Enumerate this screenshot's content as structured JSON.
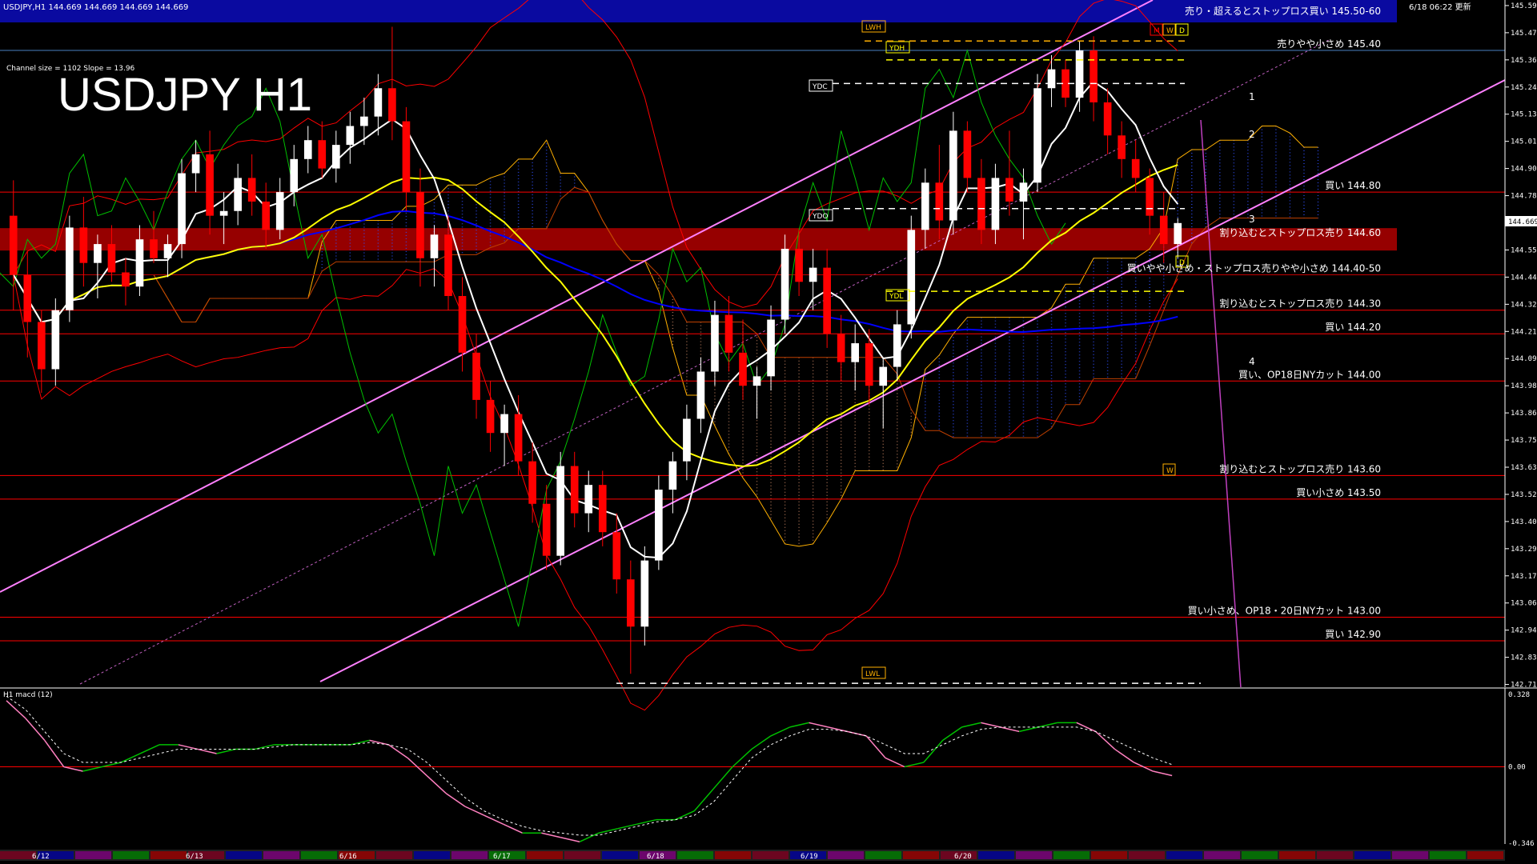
{
  "header": {
    "symbol_line": "USDJPY,H1  144.669 144.669 144.669 144.669",
    "timestamp": "6/18 06:22 更新",
    "channel_info": "Channel size = 1102 Slope = 13.96",
    "big_title": "USDJPY  H1",
    "macd_label": "H1  macd (12)"
  },
  "colors": {
    "background": "#000000",
    "bull_candle": "#ffffff",
    "bear_candle": "#ff0000",
    "channel": "#ff80ff",
    "ma_fast": "#ffffff",
    "ma_mid": "#ffff00",
    "ma_slow": "#0000ff",
    "bollinger": "#ff0000",
    "chikou": "#00c000",
    "level_line": "#ff0000",
    "resistance_band": "#c00000",
    "top_band": "#1010c0",
    "macd_main": "#00c000",
    "macd_main_neg": "#ff80c0",
    "macd_signal": "#ffffff"
  },
  "chart_data": {
    "type": "candlestick",
    "y_axis": {
      "ticks": [
        "145.590",
        "145.475",
        "145.360",
        "145.245",
        "145.130",
        "145.015",
        "144.900",
        "144.785",
        "144.669",
        "144.555",
        "144.440",
        "144.325",
        "144.210",
        "144.095",
        "143.980",
        "143.865",
        "143.750",
        "143.635",
        "143.520",
        "143.405",
        "143.290",
        "143.175",
        "143.060",
        "142.945",
        "142.830",
        "142.715"
      ],
      "range": [
        142.7,
        145.6
      ],
      "current_price": "144.669"
    },
    "x_axis": {
      "labels": [
        "6/12",
        "6/13",
        "6/16",
        "6/17",
        "6/18",
        "6/19",
        "6/20"
      ]
    },
    "ohlc": [
      [
        144.7,
        144.85,
        144.3,
        144.45
      ],
      [
        144.45,
        144.55,
        144.1,
        144.25
      ],
      [
        144.25,
        144.3,
        143.95,
        144.05
      ],
      [
        144.05,
        144.35,
        143.98,
        144.3
      ],
      [
        144.3,
        144.7,
        144.25,
        144.65
      ],
      [
        144.65,
        144.78,
        144.4,
        144.5
      ],
      [
        144.5,
        144.62,
        144.35,
        144.58
      ],
      [
        144.58,
        144.66,
        144.42,
        144.46
      ],
      [
        144.46,
        144.52,
        144.32,
        144.4
      ],
      [
        144.4,
        144.66,
        144.36,
        144.6
      ],
      [
        144.6,
        144.72,
        144.5,
        144.52
      ],
      [
        144.52,
        144.62,
        144.44,
        144.58
      ],
      [
        144.58,
        144.94,
        144.52,
        144.88
      ],
      [
        144.88,
        145.02,
        144.8,
        144.96
      ],
      [
        144.96,
        145.06,
        144.62,
        144.7
      ],
      [
        144.7,
        144.8,
        144.58,
        144.72
      ],
      [
        144.72,
        144.92,
        144.66,
        144.86
      ],
      [
        144.86,
        144.96,
        144.7,
        144.76
      ],
      [
        144.76,
        144.84,
        144.56,
        144.64
      ],
      [
        144.64,
        144.86,
        144.6,
        144.8
      ],
      [
        144.8,
        145.0,
        144.74,
        144.94
      ],
      [
        144.94,
        145.08,
        144.88,
        145.02
      ],
      [
        145.02,
        145.1,
        144.86,
        144.9
      ],
      [
        144.9,
        145.06,
        144.84,
        145.0
      ],
      [
        145.0,
        145.14,
        144.92,
        145.08
      ],
      [
        145.08,
        145.2,
        145.0,
        145.12
      ],
      [
        145.12,
        145.3,
        145.04,
        145.24
      ],
      [
        145.24,
        145.5,
        145.02,
        145.1
      ],
      [
        145.1,
        145.16,
        144.72,
        144.8
      ],
      [
        144.8,
        144.9,
        144.4,
        144.52
      ],
      [
        144.52,
        144.66,
        144.4,
        144.62
      ],
      [
        144.62,
        144.7,
        144.3,
        144.36
      ],
      [
        144.36,
        144.44,
        144.04,
        144.12
      ],
      [
        144.12,
        144.2,
        143.84,
        143.92
      ],
      [
        143.92,
        144.0,
        143.7,
        143.78
      ],
      [
        143.78,
        143.9,
        143.64,
        143.86
      ],
      [
        143.86,
        143.94,
        143.6,
        143.66
      ],
      [
        143.66,
        143.74,
        143.4,
        143.48
      ],
      [
        143.48,
        143.56,
        143.2,
        143.26
      ],
      [
        143.26,
        143.7,
        143.22,
        143.64
      ],
      [
        143.64,
        143.7,
        143.38,
        143.44
      ],
      [
        143.44,
        143.62,
        143.36,
        143.56
      ],
      [
        143.56,
        143.62,
        143.3,
        143.36
      ],
      [
        143.36,
        143.44,
        143.1,
        143.16
      ],
      [
        143.16,
        143.24,
        142.76,
        142.96
      ],
      [
        142.96,
        143.3,
        142.88,
        143.24
      ],
      [
        143.24,
        143.6,
        143.2,
        143.54
      ],
      [
        143.54,
        143.7,
        143.44,
        143.66
      ],
      [
        143.66,
        143.9,
        143.58,
        143.84
      ],
      [
        143.84,
        144.1,
        143.78,
        144.04
      ],
      [
        144.04,
        144.34,
        143.98,
        144.28
      ],
      [
        144.28,
        144.36,
        144.04,
        144.12
      ],
      [
        144.12,
        144.26,
        143.92,
        143.98
      ],
      [
        143.98,
        144.06,
        143.84,
        144.02
      ],
      [
        144.02,
        144.32,
        143.96,
        144.26
      ],
      [
        144.26,
        144.62,
        144.2,
        144.56
      ],
      [
        144.56,
        144.64,
        144.36,
        144.42
      ],
      [
        144.42,
        144.56,
        144.3,
        144.48
      ],
      [
        144.48,
        144.56,
        144.14,
        144.2
      ],
      [
        144.2,
        144.28,
        144.0,
        144.08
      ],
      [
        144.08,
        144.24,
        143.96,
        144.16
      ],
      [
        144.16,
        144.22,
        143.9,
        143.98
      ],
      [
        143.98,
        144.1,
        143.8,
        144.06
      ],
      [
        144.06,
        144.3,
        144.0,
        144.24
      ],
      [
        144.24,
        144.7,
        144.18,
        144.64
      ],
      [
        144.64,
        144.9,
        144.56,
        144.84
      ],
      [
        144.84,
        145.0,
        144.6,
        144.68
      ],
      [
        144.68,
        145.14,
        144.62,
        145.06
      ],
      [
        145.06,
        145.1,
        144.8,
        144.86
      ],
      [
        144.86,
        144.94,
        144.58,
        144.64
      ],
      [
        144.64,
        144.92,
        144.58,
        144.86
      ],
      [
        144.86,
        145.06,
        144.7,
        144.76
      ],
      [
        144.76,
        144.9,
        144.6,
        144.84
      ],
      [
        144.84,
        145.3,
        144.8,
        145.24
      ],
      [
        145.24,
        145.38,
        145.16,
        145.32
      ],
      [
        145.32,
        145.36,
        145.16,
        145.2
      ],
      [
        145.2,
        145.44,
        145.14,
        145.4
      ],
      [
        145.4,
        145.46,
        145.1,
        145.18
      ],
      [
        145.18,
        145.24,
        144.96,
        145.04
      ],
      [
        145.04,
        145.1,
        144.86,
        144.94
      ],
      [
        144.94,
        145.02,
        144.8,
        144.86
      ],
      [
        144.86,
        144.9,
        144.62,
        144.7
      ],
      [
        144.7,
        144.8,
        144.5,
        144.58
      ],
      [
        144.58,
        144.69,
        144.52,
        144.669
      ]
    ],
    "horizontal_levels": [
      {
        "price": 145.55,
        "label": "売り・超えるとストップロス買い 145.50-60",
        "color": "#1010c0"
      },
      {
        "price": 145.4,
        "label": "売りやや小さめ 145.40",
        "color": "#4a7fc0"
      },
      {
        "price": 144.8,
        "label": "買い 144.80",
        "color": "#ff0000"
      },
      {
        "price": 144.6,
        "label": "割り込むとストップロス売り 144.60",
        "color": "#ff0000"
      },
      {
        "price": 144.45,
        "label": "買いやや小さめ・ストップロス売りやや小さめ 144.40-50",
        "color": "#c00000"
      },
      {
        "price": 144.3,
        "label": "割り込むとストップロス売り 144.30",
        "color": "#ff0000"
      },
      {
        "price": 144.2,
        "label": "買い 144.20",
        "color": "#ff0000"
      },
      {
        "price": 144.0,
        "label": "買い、OP18日NYカット 144.00",
        "color": "#ff0000"
      },
      {
        "price": 143.6,
        "label": "割り込むとストップロス売り 143.60",
        "color": "#ff0000"
      },
      {
        "price": 143.5,
        "label": "買い小さめ 143.50",
        "color": "#ff0000"
      },
      {
        "price": 143.0,
        "label": "買い小さめ、OP18・20日NYカット 143.00",
        "color": "#ff0000"
      },
      {
        "price": 142.9,
        "label": "買い 142.90",
        "color": "#ff0000"
      }
    ],
    "markers": {
      "LWH": "LWH",
      "YDH": "YDH",
      "YDC": "YDC",
      "YDO": "YDO",
      "YDL": "YDL",
      "LWL": "LWL",
      "W": "W",
      "D": "D",
      "M": "M",
      "wave_numbers": [
        "1",
        "2",
        "3",
        "4"
      ]
    },
    "macd_axis": {
      "ticks": [
        "0.328",
        "0.00",
        "-0.346"
      ]
    },
    "macd_main": [
      0.3,
      0.22,
      0.12,
      0.0,
      -0.02,
      0.0,
      0.02,
      0.06,
      0.1,
      0.1,
      0.08,
      0.06,
      0.08,
      0.08,
      0.1,
      0.1,
      0.1,
      0.1,
      0.1,
      0.12,
      0.1,
      0.04,
      -0.04,
      -0.12,
      -0.18,
      -0.22,
      -0.26,
      -0.3,
      -0.3,
      -0.32,
      -0.34,
      -0.3,
      -0.28,
      -0.26,
      -0.24,
      -0.24,
      -0.2,
      -0.1,
      0.0,
      0.08,
      0.14,
      0.18,
      0.2,
      0.18,
      0.16,
      0.14,
      0.04,
      0.0,
      0.02,
      0.12,
      0.18,
      0.2,
      0.18,
      0.16,
      0.18,
      0.2,
      0.2,
      0.16,
      0.08,
      0.02,
      -0.02,
      -0.04
    ],
    "macd_signal": [
      0.32,
      0.26,
      0.16,
      0.06,
      0.02,
      0.02,
      0.02,
      0.04,
      0.06,
      0.08,
      0.08,
      0.08,
      0.08,
      0.08,
      0.09,
      0.1,
      0.1,
      0.1,
      0.1,
      0.11,
      0.1,
      0.08,
      0.02,
      -0.06,
      -0.14,
      -0.2,
      -0.24,
      -0.27,
      -0.29,
      -0.3,
      -0.31,
      -0.31,
      -0.29,
      -0.27,
      -0.25,
      -0.24,
      -0.22,
      -0.16,
      -0.06,
      0.04,
      0.1,
      0.14,
      0.17,
      0.17,
      0.16,
      0.14,
      0.1,
      0.06,
      0.06,
      0.1,
      0.14,
      0.17,
      0.18,
      0.18,
      0.18,
      0.18,
      0.18,
      0.16,
      0.12,
      0.08,
      0.04,
      0.01
    ]
  }
}
